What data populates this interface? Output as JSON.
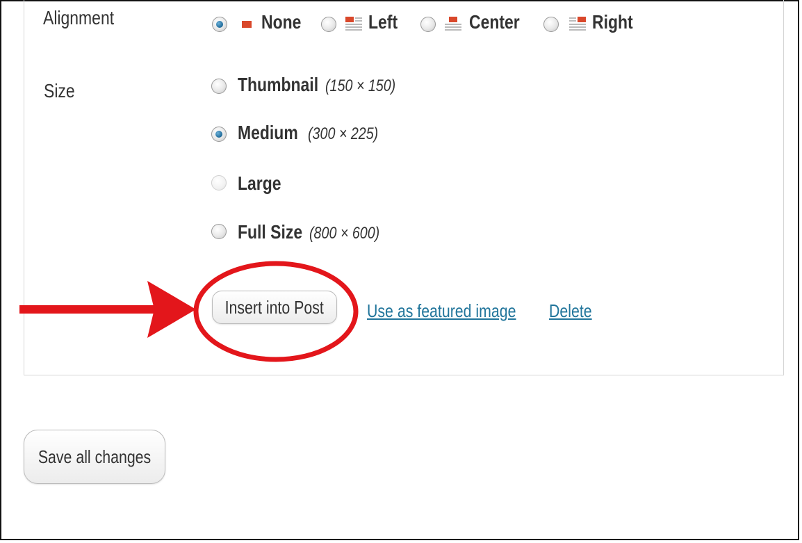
{
  "alignment": {
    "label": "Alignment",
    "selected": "None",
    "options": [
      {
        "label": "None",
        "icon": "align-none-icon"
      },
      {
        "label": "Left",
        "icon": "align-left-icon"
      },
      {
        "label": "Center",
        "icon": "align-center-icon"
      },
      {
        "label": "Right",
        "icon": "align-right-icon"
      }
    ]
  },
  "size": {
    "label": "Size",
    "selected": "Medium",
    "options": [
      {
        "label": "Thumbnail",
        "dims": "(150 × 150)"
      },
      {
        "label": "Medium",
        "dims": "(300 × 225)"
      },
      {
        "label": "Large",
        "dims": ""
      },
      {
        "label": "Full Size",
        "dims": "(800 × 600)"
      }
    ]
  },
  "actions": {
    "insert_label": "Insert into Post",
    "featured_label": "Use as featured image",
    "delete_label": "Delete"
  },
  "footer": {
    "save_label": "Save all changes"
  },
  "colors": {
    "annotation": "#e3161b",
    "link": "#21759b",
    "radio_selected": "#1f6a99",
    "icon_red": "#d9482b"
  }
}
